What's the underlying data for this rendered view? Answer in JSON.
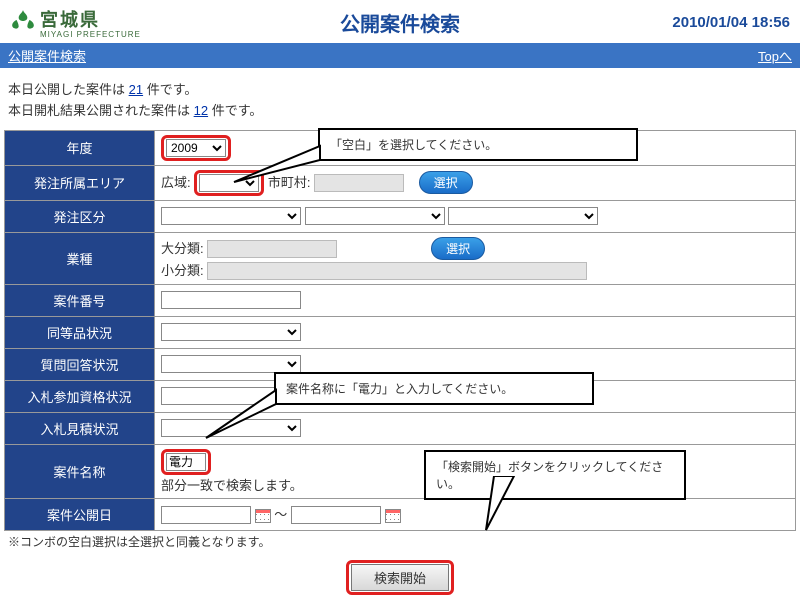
{
  "header": {
    "prefecture": "宮城県",
    "prefecture_en": "MIYAGI PREFECTURE",
    "page_title": "公開案件検索",
    "timestamp": "2010/01/04 18:56"
  },
  "subheader": {
    "breadcrumb": "公開案件検索",
    "top_link": "Topへ"
  },
  "intro": {
    "line1a": "本日公開した案件は ",
    "line1_link": "21",
    "line1b": " 件です。",
    "line2a": "本日開札結果公開された案件は ",
    "line2_link": "12",
    "line2b": " 件です。"
  },
  "labels": {
    "year": "年度",
    "order_area": "発注所属エリア",
    "order_class": "発注区分",
    "industry": "業種",
    "case_no": "案件番号",
    "equiv_status": "同等品状況",
    "qa_status": "質問回答状況",
    "qual_status": "入札参加資格状況",
    "est_status": "入札見積状況",
    "case_name": "案件名称",
    "pub_date": "案件公開日"
  },
  "fields": {
    "year_value": "2009",
    "wide_area_label": "広域:",
    "municipality_label": "市町村:",
    "select_btn": "選択",
    "major_cat_label": "大分類:",
    "minor_cat_label": "小分類:",
    "case_name_value": "電力",
    "partial_match_text": "部分一致で検索します。",
    "date_sep": "～",
    "note": "※コンボの空白選択は全選択と同義となります。",
    "search_btn": "検索開始"
  },
  "callouts": {
    "c1": "「空白」を選択してください。",
    "c2": "案件名称に「電力」と入力してください。",
    "c3": "「検索開始」ボタンをクリックしてください。"
  }
}
